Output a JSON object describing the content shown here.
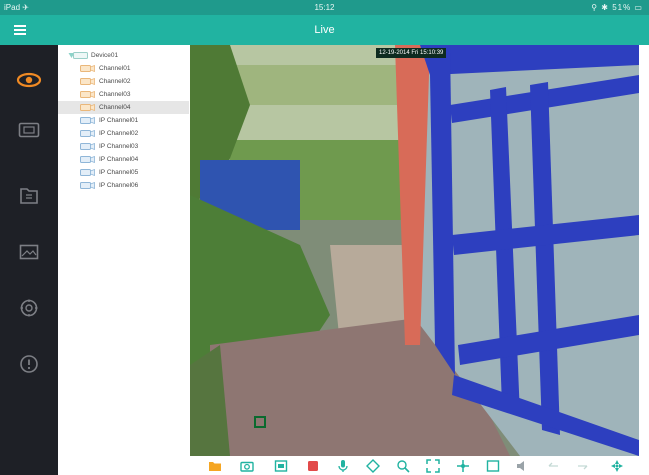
{
  "status_bar": {
    "left": "iPad ✈",
    "time": "15:12",
    "right": "⚲ ✱ 51% ▭"
  },
  "app_bar": {
    "title": "Live"
  },
  "nav": [
    {
      "name": "live-view-icon",
      "active": true
    },
    {
      "name": "playback-icon",
      "active": false
    },
    {
      "name": "file-manager-icon",
      "active": false
    },
    {
      "name": "image-gallery-icon",
      "active": false
    },
    {
      "name": "settings-icon",
      "active": false
    },
    {
      "name": "info-icon",
      "active": false
    }
  ],
  "device_tree": {
    "device": "Device01",
    "channels": [
      {
        "label": "Channel01"
      },
      {
        "label": "Channel02"
      },
      {
        "label": "Channel03"
      },
      {
        "label": "Channel04",
        "selected": true
      },
      {
        "label": "IP Channel01"
      },
      {
        "label": "IP Channel02"
      },
      {
        "label": "IP Channel03"
      },
      {
        "label": "IP Channel04"
      },
      {
        "label": "IP Channel05"
      },
      {
        "label": "IP Channel06"
      }
    ]
  },
  "video": {
    "osd": "12-19-2014 Fri 15:10:39"
  },
  "toolbar": [
    "folder-icon",
    "snapshot-icon",
    "record-icon",
    "stop-icon",
    "microphone-icon",
    "ptz-icon",
    "zoom-icon",
    "fullscreen-icon",
    "split-screen-icon",
    "quality-icon",
    "audio-icon",
    "previous-icon",
    "next-icon",
    "ptz-control-icon"
  ],
  "colors": {
    "accent": "#21b3a1",
    "accent_dark": "#1f9a8c",
    "nav_bg": "#1e2026",
    "active_icon": "#f08a24",
    "icon_gray": "#7d7f85",
    "toolbar_icon": "#21b3a1",
    "record_red": "#e24a4a"
  }
}
